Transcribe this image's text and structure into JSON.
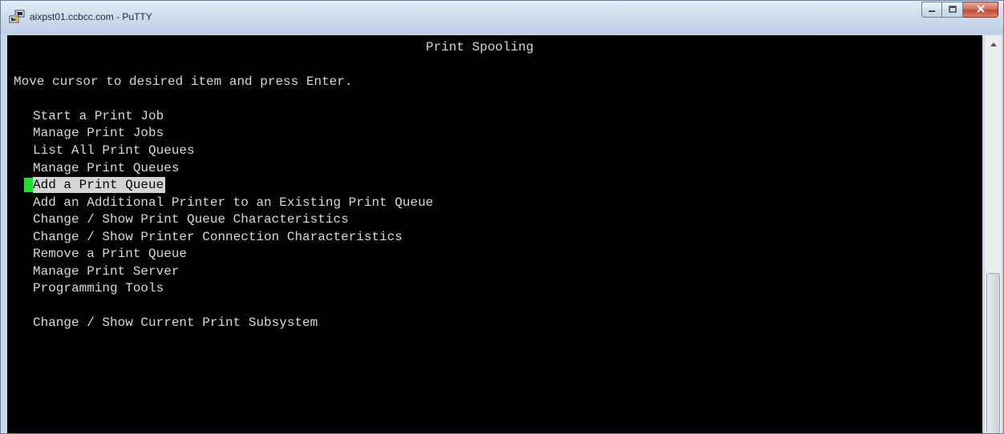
{
  "window": {
    "title": "aixpst01.ccbcc.com - PuTTY",
    "icon": "putty-icon",
    "buttons": [
      "minimize-icon",
      "maximize-icon",
      "close-icon"
    ]
  },
  "terminal": {
    "header": "Print Spooling",
    "instruction": "Move cursor to desired item and press Enter.",
    "menu_items": [
      {
        "label": "Start a Print Job",
        "selected": false
      },
      {
        "label": "Manage Print Jobs",
        "selected": false
      },
      {
        "label": "List All Print Queues",
        "selected": false
      },
      {
        "label": "Manage Print Queues",
        "selected": false
      },
      {
        "label": "Add a Print Queue",
        "selected": true
      },
      {
        "label": "Add an Additional Printer to an Existing Print Queue",
        "selected": false
      },
      {
        "label": "Change / Show Print Queue Characteristics",
        "selected": false
      },
      {
        "label": "Change / Show Printer Connection Characteristics",
        "selected": false
      },
      {
        "label": "Remove a Print Queue",
        "selected": false
      },
      {
        "label": "Manage Print Server",
        "selected": false
      },
      {
        "label": "Programming Tools",
        "selected": false
      }
    ],
    "extra_item": "Change / Show Current Print Subsystem",
    "colors": {
      "background": "#000000",
      "foreground": "#d8d8d8",
      "selection": "#d4d4d4",
      "cursor": "#22dd33"
    }
  }
}
